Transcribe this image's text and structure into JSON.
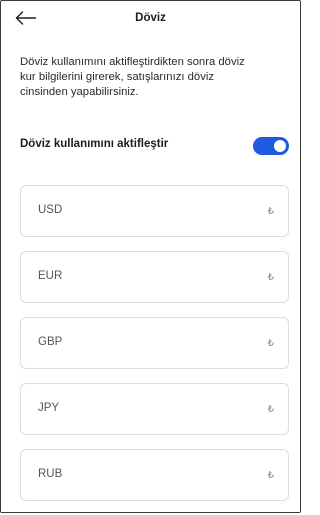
{
  "header": {
    "back_icon": "arrow-left-icon",
    "title": "Döviz"
  },
  "description": "Döviz kullanımını aktifleştirdikten sonra döviz\nkur bilgilerini girerek, satışlarınızı döviz\ncinsinden yapabilirsiniz.",
  "toggle": {
    "label": "Döviz kullanımını aktifleştir",
    "enabled": true,
    "color": "#1f5ae0"
  },
  "currencies": [
    {
      "code": "USD",
      "suffix": "₺",
      "value": ""
    },
    {
      "code": "EUR",
      "suffix": "₺",
      "value": ""
    },
    {
      "code": "GBP",
      "suffix": "₺",
      "value": ""
    },
    {
      "code": "JPY",
      "suffix": "₺",
      "value": ""
    },
    {
      "code": "RUB",
      "suffix": "₺",
      "value": ""
    }
  ]
}
